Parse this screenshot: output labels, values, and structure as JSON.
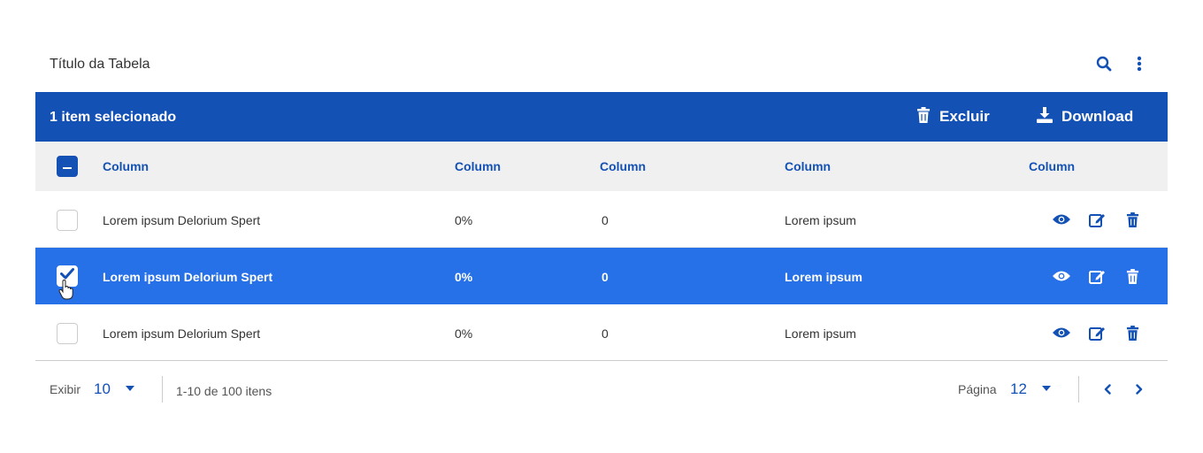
{
  "header": {
    "title": "Título da Tabela",
    "icons": [
      "search-icon",
      "more-vertical-icon"
    ]
  },
  "selection_bar": {
    "text": "1 item selecionado",
    "delete_label": "Excluir",
    "download_label": "Download"
  },
  "columns": [
    "Column",
    "Column",
    "Column",
    "Column",
    "Column"
  ],
  "rows": [
    {
      "checked": false,
      "c1": "Lorem ipsum Delorium Spert",
      "c2": "0%",
      "c3": "0",
      "c4": "Lorem ipsum"
    },
    {
      "checked": true,
      "c1": "Lorem ipsum Delorium Spert",
      "c2": "0%",
      "c3": "0",
      "c4": "Lorem ipsum"
    },
    {
      "checked": false,
      "c1": "Lorem ipsum Delorium Spert",
      "c2": "0%",
      "c3": "0",
      "c4": "Lorem ipsum"
    }
  ],
  "row_actions": [
    "eye-icon",
    "edit-icon",
    "trash-icon"
  ],
  "footer": {
    "show_label": "Exibir",
    "show_value": "10",
    "range_text": "1-10 de 100 itens",
    "page_label": "Página",
    "page_value": "12"
  },
  "colors": {
    "primary": "#1351b4",
    "selected_row": "#2670e8",
    "header_bg": "#f0f0f0"
  }
}
